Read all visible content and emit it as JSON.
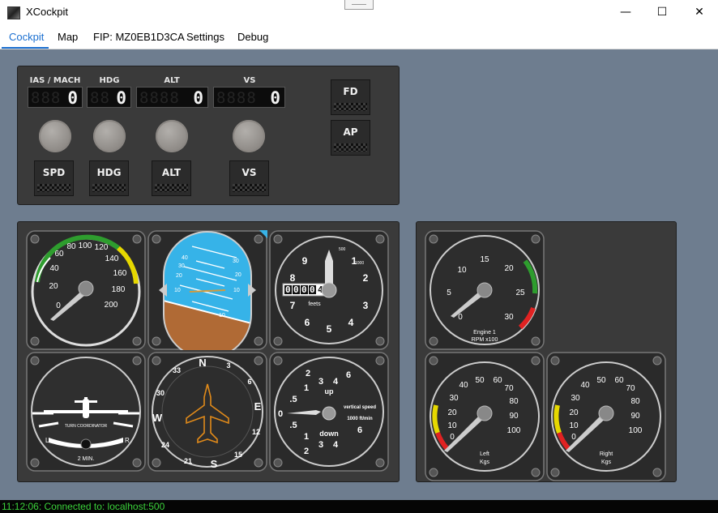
{
  "window": {
    "title": "XCockpit",
    "minimize": "—",
    "maximize": "☐",
    "close": "✕"
  },
  "tabs": [
    {
      "label": "Cockpit",
      "active": true
    },
    {
      "label": "Map"
    },
    {
      "label": "FIP: MZ0EB1D3CA"
    },
    {
      "label": "Settings"
    },
    {
      "label": "Debug"
    }
  ],
  "autopilot": {
    "displays": [
      {
        "label": "IAS / MACH",
        "value": "0"
      },
      {
        "label": "HDG",
        "value": "0"
      },
      {
        "label": "ALT",
        "value": "0"
      },
      {
        "label": "VS",
        "value": "0"
      }
    ],
    "buttons": [
      "SPD",
      "HDG",
      "ALT",
      "VS"
    ],
    "side_buttons": [
      "FD",
      "AP"
    ]
  },
  "gauges": {
    "airspeed": {
      "ticks": [
        "40",
        "60",
        "80",
        "100",
        "120",
        "140",
        "160",
        "180",
        "200",
        "20",
        "0"
      ],
      "value": 0
    },
    "altimeter": {
      "digits": [
        "0",
        "0",
        "0",
        "0",
        "4"
      ],
      "unit": "feets",
      "ticks": [
        "0",
        "1",
        "2",
        "3",
        "4",
        "5",
        "6",
        "7",
        "8",
        "9"
      ],
      "small": "500",
      "small2": "1000"
    },
    "attitude": {
      "pitch_labels": [
        "40",
        "30",
        "20",
        "10",
        "20",
        "10",
        "30",
        "10"
      ]
    },
    "turn_coordinator": {
      "title": "TURN COORDINATOR",
      "left": "L",
      "right": "R",
      "minutes": "2 MIN."
    },
    "heading": {
      "labels": [
        "N",
        "3",
        "6",
        "E",
        "12",
        "15",
        "S",
        "21",
        "24",
        "W",
        "30",
        "33"
      ]
    },
    "vertical_speed": {
      "up": "up",
      "down": "down",
      "title": "vertical speed",
      "unit": "1000 ft/min",
      "nums": [
        "1",
        "2",
        "3",
        "4",
        "6",
        "1",
        "2",
        "3",
        "4",
        "6",
        ".5",
        ".5",
        "0"
      ]
    },
    "rpm": {
      "ticks": [
        "0",
        "5",
        "10",
        "15",
        "20",
        "25",
        "30"
      ],
      "label1": "Engine 1",
      "label2": "RPM x100"
    },
    "fuel_left": {
      "ticks": [
        "0",
        "10",
        "20",
        "30",
        "40",
        "50",
        "60",
        "70",
        "80",
        "90",
        "100"
      ],
      "label1": "Left",
      "label2": "Kgs"
    },
    "fuel_right": {
      "ticks": [
        "0",
        "10",
        "20",
        "30",
        "40",
        "50",
        "60",
        "70",
        "80",
        "90",
        "100"
      ],
      "label1": "Right",
      "label2": "Kgs"
    }
  },
  "status": {
    "text": "11:12:06: Connected to: localhost:500"
  }
}
